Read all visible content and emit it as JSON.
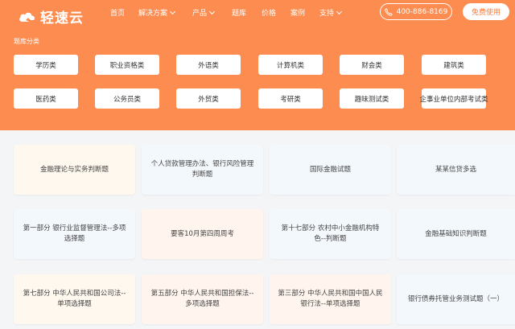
{
  "brand": {
    "name": "轻速云",
    "accent": "#fd8c50"
  },
  "nav": [
    {
      "label": "首页",
      "dropdown": false
    },
    {
      "label": "解决方案",
      "dropdown": true
    },
    {
      "label": "产品",
      "dropdown": true
    },
    {
      "label": "题库",
      "dropdown": false
    },
    {
      "label": "价格",
      "dropdown": false
    },
    {
      "label": "案例",
      "dropdown": false
    },
    {
      "label": "支持",
      "dropdown": true
    }
  ],
  "header": {
    "phone": "400-886-8169",
    "free_button": "免费使用"
  },
  "categories": {
    "title": "题库分类",
    "items": [
      "学历类",
      "职业资格类",
      "外语类",
      "计算机类",
      "财会类",
      "建筑类",
      "医药类",
      "公务员类",
      "外贸类",
      "考研类",
      "趣味测试类",
      "企事业单位内部考试类"
    ]
  },
  "cards": [
    "金融理论与实务判断题",
    "个人贷款管理办法、银行风险管理判断题",
    "国际金融试题",
    "某某信贷多选",
    "第一部分 银行业监督管理法--多项选择题",
    "要客10月第四周周考",
    "第十七部分 农村中小金融机构特色--判断题",
    "金融基础知识判断题",
    "第七部分 中华人民共和国公司法--单项选择题",
    "第五部分 中华人民共和国担保法--多项选择题",
    "第三部分 中华人民共和国中国人民银行法--单项选择题",
    "银行债券托管业务测试题（一）"
  ]
}
